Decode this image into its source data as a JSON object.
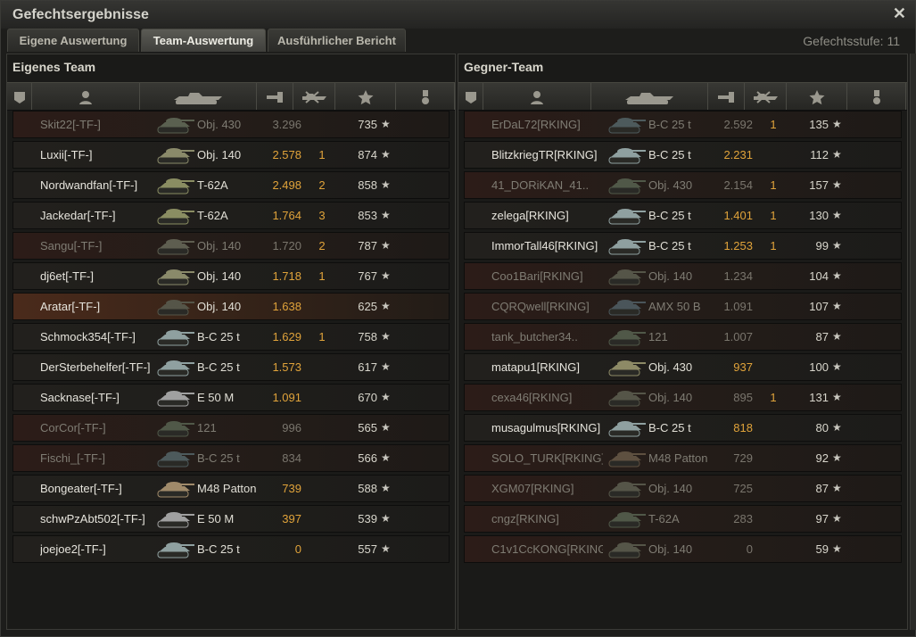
{
  "window": {
    "title": "Gefechtsergebnisse",
    "close_glyph": "✕"
  },
  "tabs": [
    {
      "label": "Eigene Auswertung",
      "active": false
    },
    {
      "label": "Team-Auswertung",
      "active": true
    },
    {
      "label": "Ausführlicher Bericht",
      "active": false
    }
  ],
  "battle_level": "Gefechtsstufe: 11",
  "columns_icons": [
    "squad-icon",
    "player-icon",
    "tank-icon",
    "damage-icon",
    "kills-icon",
    "xp-star-icon",
    "medal-icon"
  ],
  "star_glyph": "★",
  "own_team": {
    "title": "Eigenes Team",
    "rows": [
      {
        "player": "Skit22[-TF-]",
        "tank": "Obj. 430",
        "damage": "3.296",
        "kills": "",
        "xp": "735",
        "state": "dead",
        "camo": "#5a6050"
      },
      {
        "player": "Luxii[-TF-]",
        "tank": "Obj. 140",
        "damage": "2.578",
        "kills": "1",
        "xp": "874",
        "state": "alive",
        "camo": "#8a8a6a"
      },
      {
        "player": "Nordwandfan[-TF-]",
        "tank": "T-62A",
        "damage": "2.498",
        "kills": "2",
        "xp": "858",
        "state": "alive",
        "camo": "#8a8d62"
      },
      {
        "player": "Jackedar[-TF-]",
        "tank": "T-62A",
        "damage": "1.764",
        "kills": "3",
        "xp": "853",
        "state": "alive",
        "camo": "#8a8d62"
      },
      {
        "player": "Sangu[-TF-]",
        "tank": "Obj. 140",
        "damage": "1.720",
        "kills": "2",
        "xp": "787",
        "state": "dead",
        "camo": "#5e5e50"
      },
      {
        "player": "dj6et[-TF-]",
        "tank": "Obj. 140",
        "damage": "1.718",
        "kills": "1",
        "xp": "767",
        "state": "alive",
        "camo": "#8a8a6a"
      },
      {
        "player": "Aratar[-TF-]",
        "tank": "Obj. 140",
        "damage": "1.638",
        "kills": "",
        "xp": "625",
        "state": "self",
        "camo": "#555548"
      },
      {
        "player": "Schmock354[-TF-]",
        "tank": "B-C 25 t",
        "damage": "1.629",
        "kills": "1",
        "xp": "758",
        "state": "alive",
        "camo": "#8fa0a0"
      },
      {
        "player": "DerSterbehelfer[-TF-]",
        "tank": "B-C 25 t",
        "damage": "1.573",
        "kills": "",
        "xp": "617",
        "state": "alive",
        "camo": "#8fa0a0"
      },
      {
        "player": "Sacknase[-TF-]",
        "tank": "E 50 M",
        "damage": "1.091",
        "kills": "",
        "xp": "670",
        "state": "alive",
        "camo": "#a0a0a0"
      },
      {
        "player": "CorCor[-TF-]",
        "tank": "121",
        "damage": "996",
        "kills": "",
        "xp": "565",
        "state": "dead",
        "camo": "#505848"
      },
      {
        "player": "Fischi_[-TF-]",
        "tank": "B-C 25 t",
        "damage": "834",
        "kills": "",
        "xp": "566",
        "state": "dead",
        "camo": "#4d5a5c"
      },
      {
        "player": "Bongeater[-TF-]",
        "tank": "M48 Patton",
        "damage": "739",
        "kills": "",
        "xp": "588",
        "state": "alive",
        "camo": "#a08a6a"
      },
      {
        "player": "schwPzAbt502[-TF-]",
        "tank": "E 50 M",
        "damage": "397",
        "kills": "",
        "xp": "539",
        "state": "alive",
        "camo": "#a0a0a0"
      },
      {
        "player": "joejoe2[-TF-]",
        "tank": "B-C 25 t",
        "damage": "0",
        "kills": "",
        "xp": "557",
        "state": "alive",
        "camo": "#8fa0a0"
      }
    ]
  },
  "enemy_team": {
    "title": "Gegner-Team",
    "rows": [
      {
        "player": "ErDaL72[RKING]",
        "tank": "B-C 25 t",
        "damage": "2.592",
        "kills": "1",
        "xp": "135",
        "state": "dead",
        "camo": "#4d5a5c"
      },
      {
        "player": "BlitzkriegTR[RKING]",
        "tank": "B-C 25 t",
        "damage": "2.231",
        "kills": "",
        "xp": "112",
        "state": "alive",
        "camo": "#8fa0a0"
      },
      {
        "player": "41_DORiKAN_41..",
        "tank": "Obj. 430",
        "damage": "2.154",
        "kills": "1",
        "xp": "157",
        "state": "dead",
        "camo": "#505848"
      },
      {
        "player": "zelega[RKING]",
        "tank": "B-C 25 t",
        "damage": "1.401",
        "kills": "1",
        "xp": "130",
        "state": "alive",
        "camo": "#8fa0a0"
      },
      {
        "player": "ImmorTall46[RKING]",
        "tank": "B-C 25 t",
        "damage": "1.253",
        "kills": "1",
        "xp": "99",
        "state": "alive",
        "camo": "#8fa0a0"
      },
      {
        "player": "Coo1Bari[RKING]",
        "tank": "Obj. 140",
        "damage": "1.234",
        "kills": "",
        "xp": "104",
        "state": "dead",
        "camo": "#555548"
      },
      {
        "player": "CQRQwell[RKING]",
        "tank": "AMX 50 B",
        "damage": "1.091",
        "kills": "",
        "xp": "107",
        "state": "dead",
        "camo": "#4a555a"
      },
      {
        "player": "tank_butcher34..",
        "tank": "121",
        "damage": "1.007",
        "kills": "",
        "xp": "87",
        "state": "dead",
        "camo": "#505848"
      },
      {
        "player": "matapu1[RKING]",
        "tank": "Obj. 430",
        "damage": "937",
        "kills": "",
        "xp": "100",
        "state": "alive",
        "camo": "#8d8a66"
      },
      {
        "player": "cexa46[RKING]",
        "tank": "Obj. 140",
        "damage": "895",
        "kills": "1",
        "xp": "131",
        "state": "dead",
        "camo": "#555548"
      },
      {
        "player": "musagulmus[RKING]",
        "tank": "B-C 25 t",
        "damage": "818",
        "kills": "",
        "xp": "80",
        "state": "alive",
        "camo": "#8fa0a0"
      },
      {
        "player": "SOLO_TURK[RKING]",
        "tank": "M48 Patton",
        "damage": "729",
        "kills": "",
        "xp": "92",
        "state": "dead",
        "camo": "#5e5040"
      },
      {
        "player": "XGM07[RKING]",
        "tank": "Obj. 140",
        "damage": "725",
        "kills": "",
        "xp": "87",
        "state": "dead",
        "camo": "#555548"
      },
      {
        "player": "cngz[RKING]",
        "tank": "T-62A",
        "damage": "283",
        "kills": "",
        "xp": "97",
        "state": "dead",
        "camo": "#505848"
      },
      {
        "player": "C1v1CcKONG[RKING]",
        "tank": "Obj. 140",
        "damage": "0",
        "kills": "",
        "xp": "59",
        "state": "dead",
        "camo": "#555548"
      }
    ]
  }
}
